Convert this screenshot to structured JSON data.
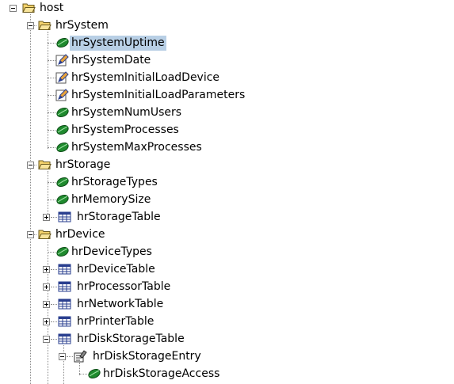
{
  "colors": {
    "selection": "#b8cfe5",
    "leaf_green": "#1f8a2e",
    "folder_yellow": "#f2d16b",
    "table_blue": "#2a3f8f"
  },
  "tree": {
    "nodes": [
      {
        "label": "host",
        "icon": "folder-open-icon",
        "toggle": "expanded"
      },
      {
        "label": "hrSystem",
        "icon": "folder-open-icon",
        "toggle": "expanded"
      },
      {
        "label": "hrSystemUptime",
        "icon": "leaf-icon",
        "selected": true
      },
      {
        "label": "hrSystemDate",
        "icon": "writable-pencil-icon"
      },
      {
        "label": "hrSystemInitialLoadDevice",
        "icon": "writable-pencil-icon"
      },
      {
        "label": "hrSystemInitialLoadParameters",
        "icon": "writable-pencil-icon"
      },
      {
        "label": "hrSystemNumUsers",
        "icon": "leaf-icon"
      },
      {
        "label": "hrSystemProcesses",
        "icon": "leaf-icon"
      },
      {
        "label": "hrSystemMaxProcesses",
        "icon": "leaf-icon"
      },
      {
        "label": "hrStorage",
        "icon": "folder-open-icon",
        "toggle": "expanded"
      },
      {
        "label": "hrStorageTypes",
        "icon": "leaf-icon"
      },
      {
        "label": "hrMemorySize",
        "icon": "leaf-icon"
      },
      {
        "label": "hrStorageTable",
        "icon": "table-icon",
        "toggle": "collapsed"
      },
      {
        "label": "hrDevice",
        "icon": "folder-open-icon",
        "toggle": "expanded"
      },
      {
        "label": "hrDeviceTypes",
        "icon": "leaf-icon"
      },
      {
        "label": "hrDeviceTable",
        "icon": "table-icon",
        "toggle": "collapsed"
      },
      {
        "label": "hrProcessorTable",
        "icon": "table-icon",
        "toggle": "collapsed"
      },
      {
        "label": "hrNetworkTable",
        "icon": "table-icon",
        "toggle": "collapsed"
      },
      {
        "label": "hrPrinterTable",
        "icon": "table-icon",
        "toggle": "collapsed"
      },
      {
        "label": "hrDiskStorageTable",
        "icon": "table-icon",
        "toggle": "expanded"
      },
      {
        "label": "hrDiskStorageEntry",
        "icon": "entry-icon",
        "toggle": "expanded"
      },
      {
        "label": "hrDiskStorageAccess",
        "icon": "leaf-icon"
      }
    ]
  }
}
